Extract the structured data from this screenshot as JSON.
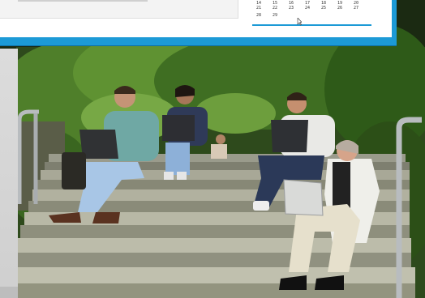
{
  "calendar": {
    "rows": [
      [
        "14",
        "15",
        "16",
        "17",
        "18",
        "19",
        "20"
      ],
      [
        "21",
        "22",
        "23",
        "24",
        "25",
        "26",
        "27"
      ],
      [
        "28",
        "29"
      ]
    ]
  }
}
